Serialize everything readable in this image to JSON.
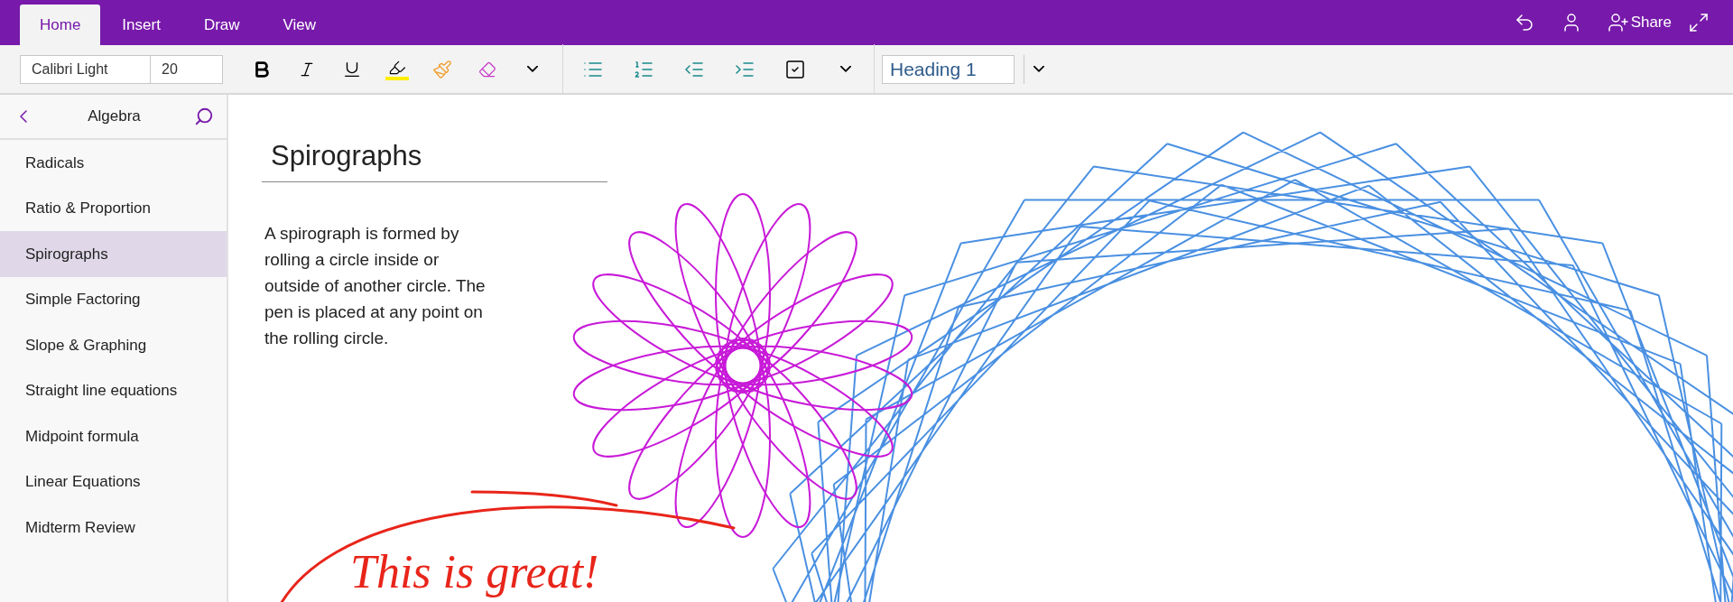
{
  "ribbon_tabs": [
    {
      "label": "Home",
      "selected": true
    },
    {
      "label": "Insert",
      "selected": false
    },
    {
      "label": "Draw",
      "selected": false
    },
    {
      "label": "View",
      "selected": false
    }
  ],
  "share": {
    "label": "Share"
  },
  "toolbar": {
    "font": "Calibri Light",
    "size": "20",
    "style": "Heading 1"
  },
  "sidebar": {
    "title": "Algebra",
    "items": [
      {
        "label": "Radicals",
        "selected": false
      },
      {
        "label": "Ratio & Proportion",
        "selected": false
      },
      {
        "label": "Spirographs",
        "selected": true
      },
      {
        "label": "Simple Factoring",
        "selected": false
      },
      {
        "label": "Slope & Graphing",
        "selected": false
      },
      {
        "label": "Straight line equations",
        "selected": false
      },
      {
        "label": "Midpoint formula",
        "selected": false
      },
      {
        "label": "Linear Equations",
        "selected": false
      },
      {
        "label": "Midterm Review",
        "selected": false
      }
    ]
  },
  "page": {
    "title": "Spirographs",
    "body": "A spirograph is formed by rolling a circle inside or outside of another circle. The pen is placed at any point on the rolling circle.",
    "ink_note": "This is great!"
  }
}
